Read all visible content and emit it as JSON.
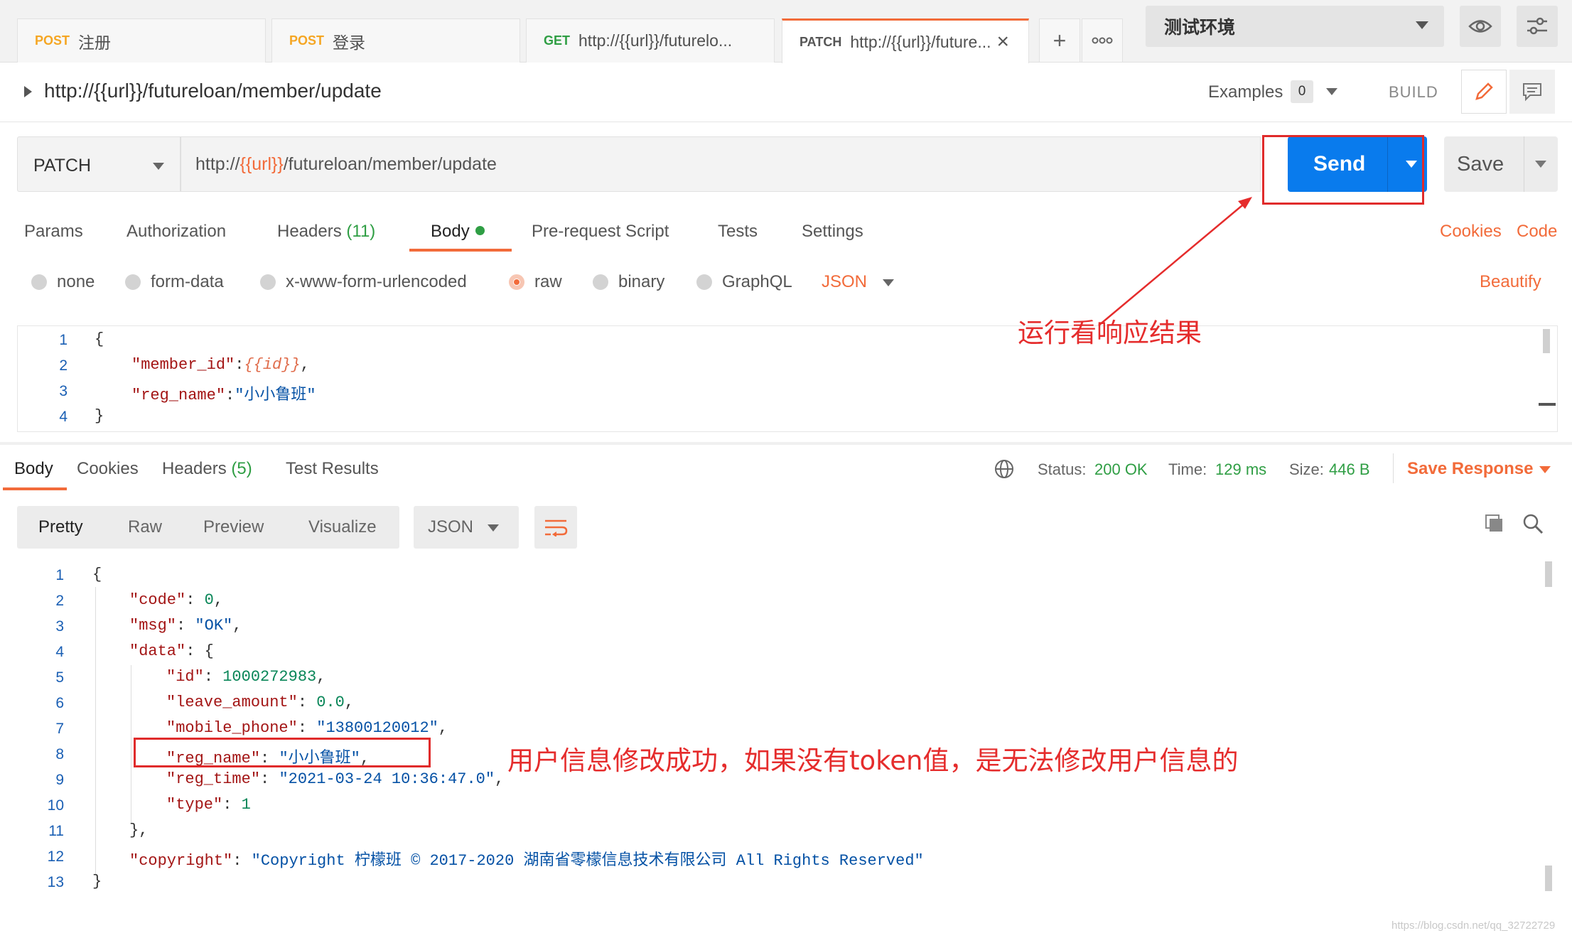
{
  "tabs": [
    {
      "method": "POST",
      "title": "注册"
    },
    {
      "method": "POST",
      "title": "登录"
    },
    {
      "method": "GET",
      "title": "http://{{url}}/futurelo..."
    },
    {
      "method": "PATCH",
      "title": "http://{{url}}/future..."
    }
  ],
  "environment": "测试环境",
  "request_name": "http://{{url}}/futureloan/member/update",
  "examples_label": "Examples",
  "examples_count": "0",
  "build_label": "BUILD",
  "method": "PATCH",
  "url": {
    "prefix": "http://",
    "var": "{{url}}",
    "suffix": "/futureloan/member/update"
  },
  "send_label": "Send",
  "save_label": "Save",
  "request_tabs": {
    "params": "Params",
    "authorization": "Authorization",
    "headers": "Headers",
    "headers_count": "(11)",
    "body": "Body",
    "prerequest": "Pre-request Script",
    "tests": "Tests",
    "settings": "Settings",
    "cookies": "Cookies",
    "code": "Code"
  },
  "body_types": [
    "none",
    "form-data",
    "x-www-form-urlencoded",
    "raw",
    "binary",
    "GraphQL"
  ],
  "body_format": "JSON",
  "beautify": "Beautify",
  "request_lines": [
    "1",
    "2",
    "3",
    "4"
  ],
  "request_body": {
    "open": "{",
    "k1": "\"member_id\"",
    "v1": "{{id}}",
    "k2": "\"reg_name\"",
    "v2": "\"小小鲁班\"",
    "close": "}"
  },
  "annotation_send": "运行看响应结果",
  "response_tabs": {
    "body": "Body",
    "cookies": "Cookies",
    "headers": "Headers",
    "headers_count": "(5)",
    "test_results": "Test Results"
  },
  "status": {
    "status_label": "Status:",
    "status_value": "200 OK",
    "time_label": "Time:",
    "time_value": "129 ms",
    "size_label": "Size:",
    "size_value": "446 B"
  },
  "save_response": "Save Response",
  "view_modes": [
    "Pretty",
    "Raw",
    "Preview",
    "Visualize"
  ],
  "response_format": "JSON",
  "response_lines": [
    "1",
    "2",
    "3",
    "4",
    "5",
    "6",
    "7",
    "8",
    "9",
    "10",
    "11",
    "12",
    "13"
  ],
  "response_body": {
    "code_key": "\"code\"",
    "code_val": "0",
    "msg_key": "\"msg\"",
    "msg_val": "\"OK\"",
    "data_key": "\"data\"",
    "id_key": "\"id\"",
    "id_val": "1000272983",
    "leave_key": "\"leave_amount\"",
    "leave_val": "0.0",
    "mobile_key": "\"mobile_phone\"",
    "mobile_val": "\"13800120012\"",
    "reg_name_key": "\"reg_name\"",
    "reg_name_val": "\"小小鲁班\"",
    "reg_time_key": "\"reg_time\"",
    "reg_time_val": "\"2021-03-24 10:36:47.0\"",
    "type_key": "\"type\"",
    "type_val": "1",
    "copyright_key": "\"copyright\"",
    "copyright_val": "\"Copyright 柠檬班 © 2017-2020 湖南省零檬信息技术有限公司 All Rights Reserved\""
  },
  "annotation_response": "用户信息修改成功，如果没有token值，是无法修改用户信息的",
  "watermark": "https://blog.csdn.net/qq_32722729",
  "colors": {
    "accent": "#f26b3a",
    "send": "#097bed",
    "annotation": "#e52c2c",
    "success": "#2f9e44"
  }
}
